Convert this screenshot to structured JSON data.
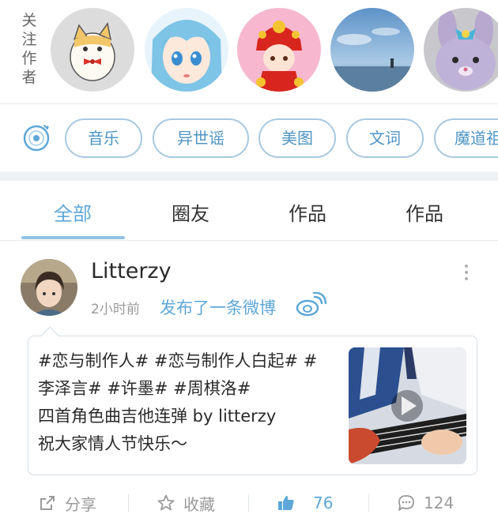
{
  "following": {
    "label": "关注作者",
    "avatars": [
      "cat-with-bowtie-icon",
      "blue-hair-anime-girl-icon",
      "lion-dance-girl-icon",
      "sky-landscape-icon",
      "plush-bunny-icon"
    ]
  },
  "tags": {
    "items": [
      "音乐",
      "异世谣",
      "美图",
      "文词",
      "魔道祖师"
    ]
  },
  "tabs": {
    "items": [
      "全部",
      "圈友",
      "作品",
      "作品"
    ],
    "active_index": 0
  },
  "post": {
    "username": "Litterzy",
    "time": "2小时前",
    "action": "发布了一条微博",
    "text_lines": [
      "#恋与制作人# #恋与制作人白起# #",
      "李泽言# #许墨# #周棋洛#",
      "四首角色曲吉他连弹 by litterzy",
      "祝大家情人节快乐～"
    ],
    "share_label": "分享",
    "favorite_label": "收藏",
    "like_count": "76",
    "comment_count": "124"
  },
  "colors": {
    "accent": "#5ea7d8",
    "tag_border": "#a7c9e0",
    "divider": "#e6e9ec",
    "muted": "#9a9a9a"
  }
}
